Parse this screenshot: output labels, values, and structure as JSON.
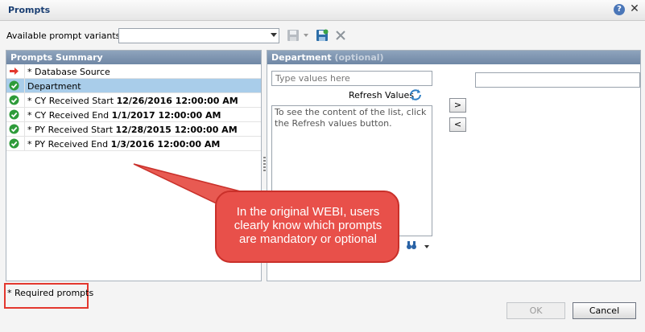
{
  "window": {
    "title": "Prompts",
    "help_glyph": "?",
    "close_glyph": "✕"
  },
  "toolbar": {
    "variants_label": "Available prompt variants",
    "variants_value": ""
  },
  "summary": {
    "header": "Prompts Summary",
    "rows": [
      {
        "text": "* Database Source",
        "value": "",
        "status": "arrow",
        "selected": false
      },
      {
        "text": "Department",
        "value": "",
        "status": "check",
        "selected": true
      },
      {
        "text": "* CY Received Start",
        "value": "12/26/2016 12:00:00 AM",
        "status": "check",
        "selected": false
      },
      {
        "text": "* CY Received End",
        "value": "1/1/2017 12:00:00 AM",
        "status": "check",
        "selected": false
      },
      {
        "text": "* PY Received Start",
        "value": "12/28/2015 12:00:00 AM",
        "status": "check",
        "selected": false
      },
      {
        "text": "* PY Received End",
        "value": "1/3/2016 12:00:00 AM",
        "status": "check",
        "selected": false
      }
    ]
  },
  "detail": {
    "header_title": "Department",
    "header_optional": "(optional)",
    "type_placeholder": "Type values here",
    "refresh_label": "Refresh Values",
    "list_hint": "To see the content of the list, click the Refresh values button.",
    "move_right_glyph": ">",
    "move_left_glyph": "<"
  },
  "callout": {
    "text": "In the original WEBI, users clearly know which prompts are mandatory or optional"
  },
  "footer": {
    "required_note": "* Required prompts",
    "ok_label": "OK",
    "cancel_label": "Cancel"
  },
  "colors": {
    "accent_red": "#e3372e",
    "header_blue": "#7b91ad",
    "selected_row": "#a9cdea",
    "check_green": "#2e9b3a"
  },
  "icons": [
    "help-icon",
    "close-icon",
    "save-icon",
    "save-green-icon",
    "delete-icon",
    "arrow-right-icon",
    "check-icon",
    "refresh-icon",
    "binoculars-icon"
  ]
}
